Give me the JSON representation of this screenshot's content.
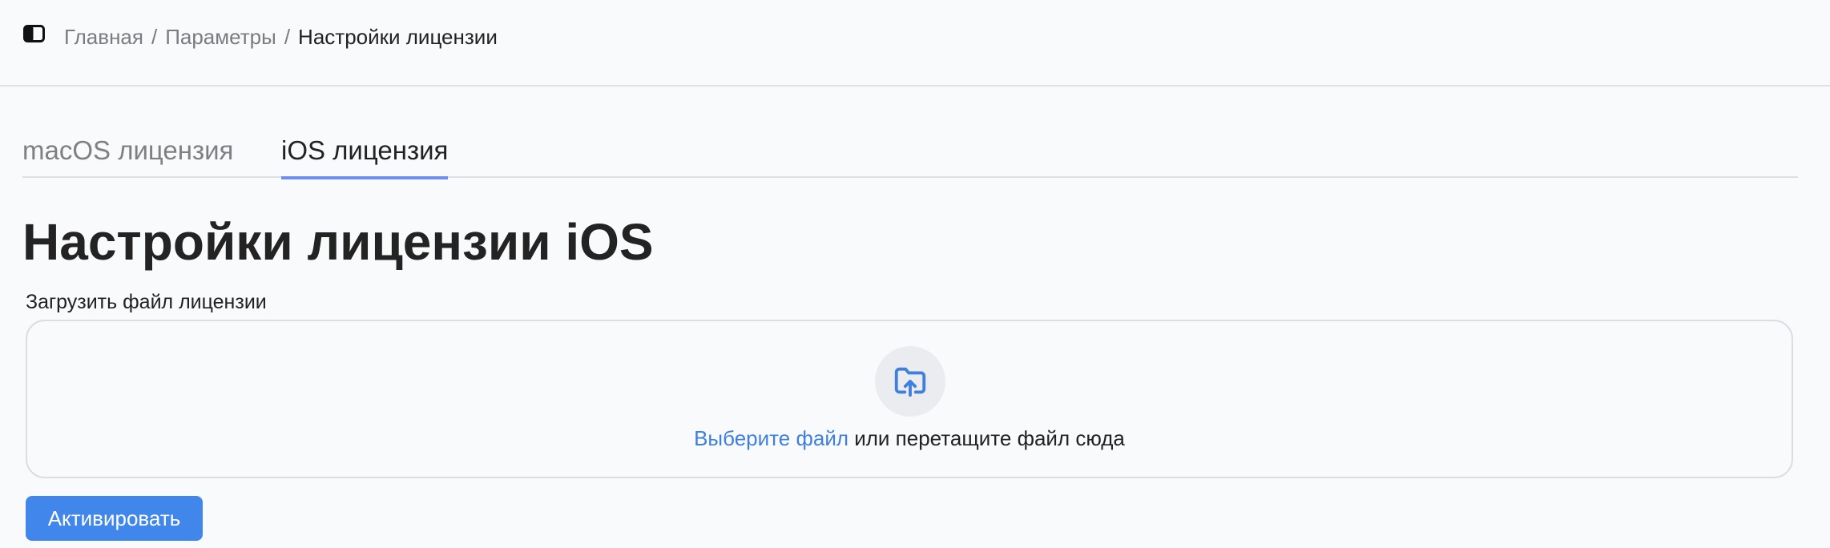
{
  "header": {
    "sidebar_toggle_icon": "sidebar-toggle-icon",
    "breadcrumb": {
      "items": [
        "Главная",
        "Параметры"
      ],
      "separator": "/",
      "current": "Настройки лицензии"
    }
  },
  "tabs": [
    {
      "label": "macOS лицензия",
      "active": false
    },
    {
      "label": "iOS лицензия",
      "active": true
    }
  ],
  "main": {
    "title": "Настройки лицензии iOS",
    "upload": {
      "label": "Загрузить файл лицензии",
      "icon": "folder-upload-icon",
      "choose_link": "Выберите файл",
      "drop_text": " или перетащите файл сюда"
    },
    "activate_button": "Активировать"
  },
  "colors": {
    "accent": "#4186eb",
    "link": "#3f7fe0",
    "active_tab_underline": "#6f8ff0"
  }
}
